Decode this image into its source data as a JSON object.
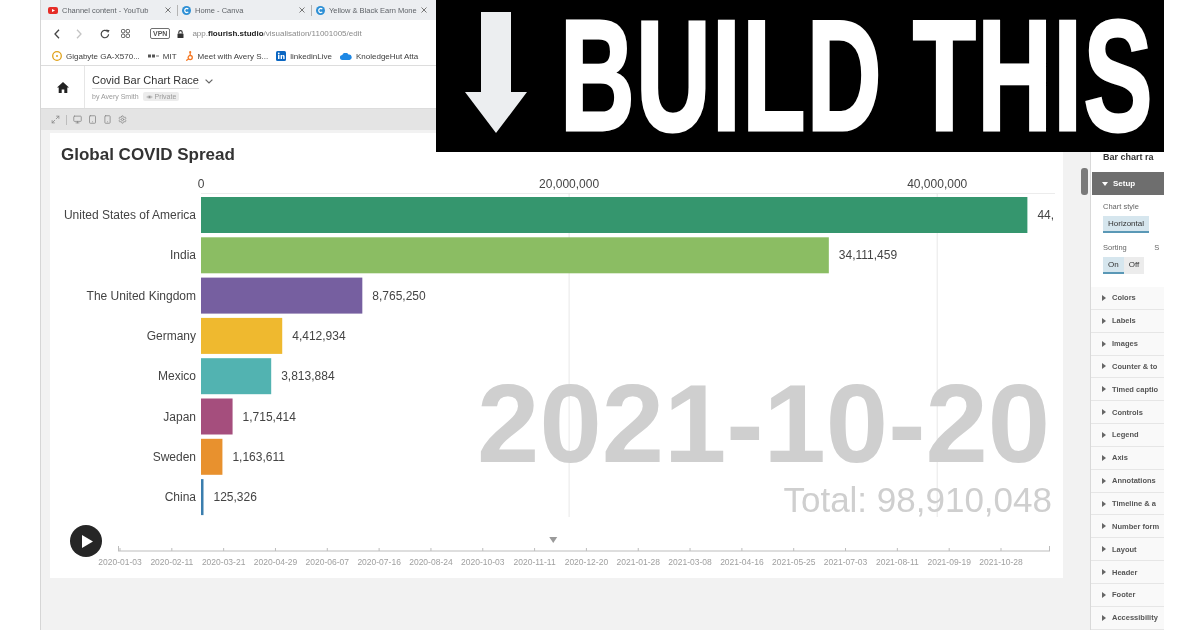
{
  "browser": {
    "tabs": [
      {
        "title": "Channel content - YouTub",
        "selected": false
      },
      {
        "title": "Home - Canva",
        "selected": false
      },
      {
        "title": "Yellow & Black Earn Mone",
        "selected": false
      }
    ],
    "back_disabled": false,
    "forward_disabled": true,
    "vpn_badge": "VPN",
    "url": "app.**flourish.studio**/visualisation/11001005/edit",
    "bookmarks": [
      "Gigabyte GA-X570...",
      "MIT",
      "Meet with Avery S...",
      "linkedinLive",
      "KnoledgeHut Atta"
    ]
  },
  "project": {
    "title": "Covid Bar Chart Race",
    "author": "by Avery Smith",
    "visibility": "Private"
  },
  "chart": {
    "chart_data": {
      "type": "bar",
      "orientation": "horizontal",
      "title": "Global COVID Spread",
      "categories": [
        "United States of America",
        "India",
        "The United Kingdom",
        "Germany",
        "Mexico",
        "Japan",
        "Sweden",
        "China"
      ],
      "values": [
        44900000,
        34111459,
        8765250,
        4412934,
        3813884,
        1715414,
        1163611,
        125326
      ],
      "colors": [
        "#35966e",
        "#8bbd63",
        "#765fa0",
        "#efb92f",
        "#52b3b1",
        "#a54e7d",
        "#e8912e",
        "#3b7eae"
      ],
      "xlim": [
        0,
        46400000
      ],
      "xticks": [
        {
          "value": 0,
          "label": "0"
        },
        {
          "value": 20000000,
          "label": "20,000,000"
        },
        {
          "value": 40000000,
          "label": "40,000,000"
        }
      ]
    },
    "value_labels": [
      "44,",
      "34,111,459",
      "8,765,250",
      "4,412,934",
      "3,813,884",
      "1,715,414",
      "1,163,611",
      "125,326"
    ],
    "counter": "2021-10-20",
    "total": "Total: 98,910,048",
    "timeline": {
      "level": 0.467,
      "labels": [
        "2020-01-03",
        "2020-02-11",
        "2020-03-21",
        "2020-04-29",
        "2020-06-07",
        "2020-07-16",
        "2020-08-24",
        "2020-10-03",
        "2020-11-11",
        "2020-12-20",
        "2021-01-28",
        "2021-03-08",
        "2021-04-16",
        "2021-05-25",
        "2021-07-03",
        "2021-08-11",
        "2021-09-19",
        "2021-10-28"
      ]
    }
  },
  "panel": {
    "title": "Bar chart ra",
    "setup": {
      "label": "Setup",
      "expanded": true
    },
    "field_rows": [
      {
        "fields": [
          {
            "label": "Chart style",
            "options": [
              {
                "label": "Horizontal",
                "selected": true
              }
            ]
          }
        ]
      },
      {
        "fields": [
          {
            "label": "Sorting",
            "options": [
              {
                "label": "On",
                "selected": true
              },
              {
                "label": "Off",
                "selected": false
              }
            ]
          },
          {
            "label": "S"
          }
        ]
      }
    ],
    "sections": [
      {
        "label": "Colors",
        "expanded": false
      },
      {
        "label": "Labels",
        "expanded": false
      },
      {
        "label": "Images",
        "expanded": false
      },
      {
        "label": "Counter & to",
        "expanded": false
      },
      {
        "label": "Timed captio",
        "expanded": false
      },
      {
        "label": "Controls",
        "expanded": false
      },
      {
        "label": "Legend",
        "expanded": false
      },
      {
        "label": "Axis",
        "expanded": false
      },
      {
        "label": "Annotations",
        "expanded": false
      },
      {
        "label": "Timeline & a",
        "expanded": false
      },
      {
        "label": "Number form",
        "expanded": false
      },
      {
        "label": "Layout",
        "expanded": false
      },
      {
        "label": "Header",
        "expanded": false
      },
      {
        "label": "Footer",
        "expanded": false
      },
      {
        "label": "Accessibility",
        "expanded": false
      }
    ]
  },
  "banner": {
    "text": "BUILD THIS"
  }
}
